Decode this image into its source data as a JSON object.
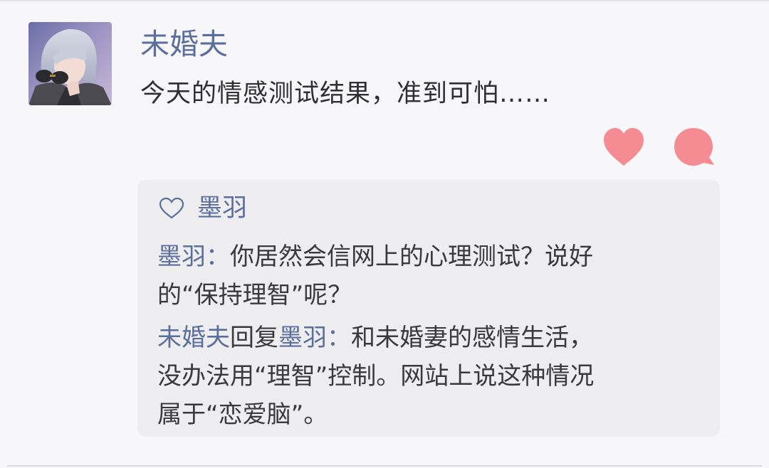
{
  "post": {
    "author": "未婚夫",
    "text": "今天的情感测试结果，准到可怕……",
    "avatar_icon": "character-avatar"
  },
  "actions": {
    "like_icon": "heart-icon",
    "comment_icon": "speech-bubble-icon",
    "accent_color": "#f58b93"
  },
  "likes": {
    "icon": "heart-outline-icon",
    "names": "墨羽"
  },
  "comments": [
    {
      "author": "墨羽",
      "separator": "：",
      "lines": [
        "你居然会信网上的心理测试？说好",
        "的“保持理智”呢？"
      ]
    },
    {
      "author": "未婚夫",
      "reply_word": "回复",
      "reply_to": "墨羽",
      "separator": "：",
      "lines": [
        "和未婚妻的感情生活，",
        "没办法用“理智”控制。网站上说这种情况",
        "属于“恋爱脑”。"
      ]
    }
  ],
  "colors": {
    "name": "#5b6e9c",
    "text": "#2f2f33",
    "background": "#f7f7f9",
    "comment_box": "#eeeef0"
  }
}
